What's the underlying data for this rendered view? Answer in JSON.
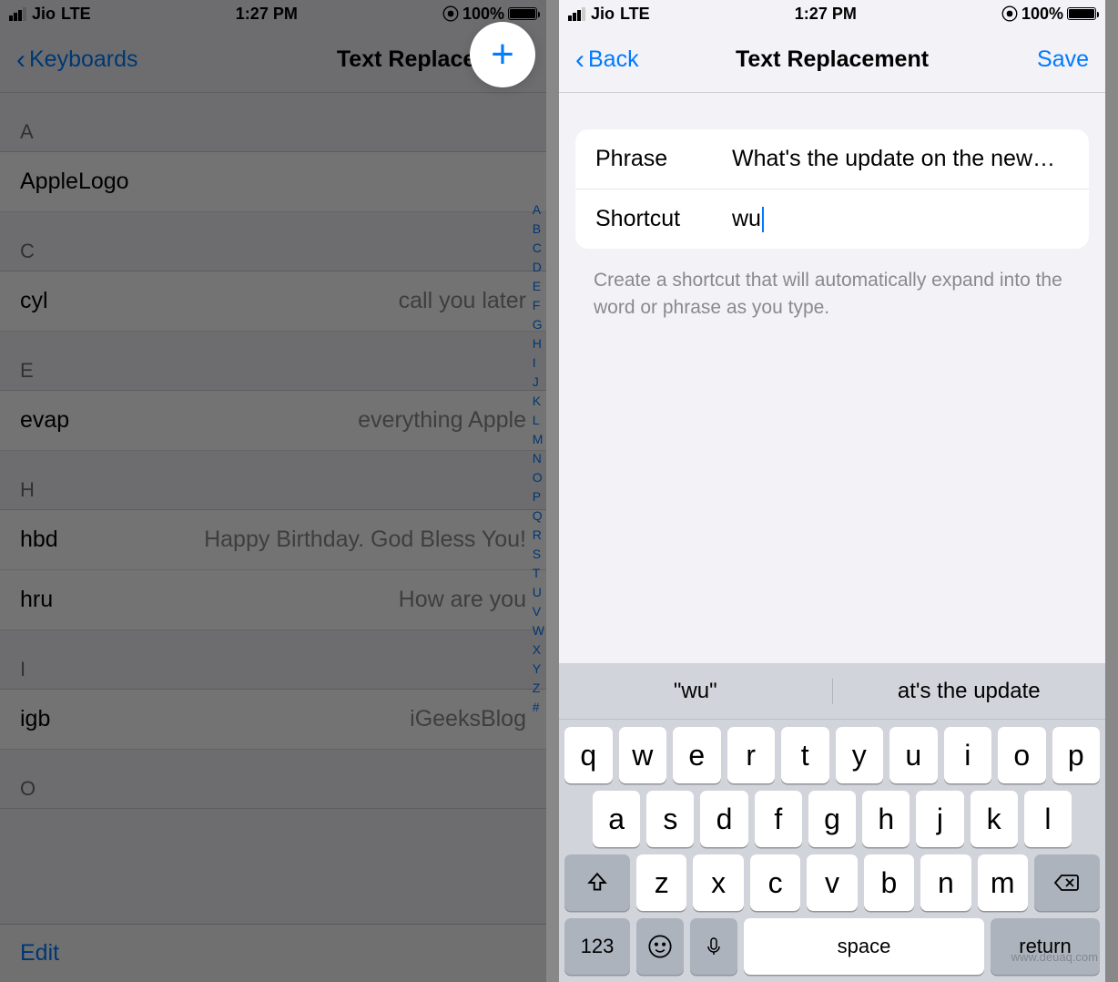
{
  "status": {
    "carrier": "Jio",
    "network": "LTE",
    "time": "1:27 PM",
    "battery_pct": "100%",
    "lock_icon": "⦿"
  },
  "left": {
    "back_label": "Keyboards",
    "title": "Text Replacement",
    "add_label": "+",
    "edit_label": "Edit",
    "sections": [
      {
        "letter": "A",
        "items": [
          {
            "shortcut": "AppleLogo",
            "phrase": ""
          }
        ]
      },
      {
        "letter": "C",
        "items": [
          {
            "shortcut": "cyl",
            "phrase": "call you later"
          }
        ]
      },
      {
        "letter": "E",
        "items": [
          {
            "shortcut": "evap",
            "phrase": "everything Apple"
          }
        ]
      },
      {
        "letter": "H",
        "items": [
          {
            "shortcut": "hbd",
            "phrase": "Happy Birthday. God Bless You!"
          },
          {
            "shortcut": "hru",
            "phrase": "How are you"
          }
        ]
      },
      {
        "letter": "I",
        "items": [
          {
            "shortcut": "igb",
            "phrase": "iGeeksBlog"
          }
        ]
      },
      {
        "letter": "O",
        "items": []
      }
    ],
    "index": [
      "A",
      "B",
      "C",
      "D",
      "E",
      "F",
      "G",
      "H",
      "I",
      "J",
      "K",
      "L",
      "M",
      "N",
      "O",
      "P",
      "Q",
      "R",
      "S",
      "T",
      "U",
      "V",
      "W",
      "X",
      "Y",
      "Z",
      "#"
    ]
  },
  "right": {
    "back_label": "Back",
    "title": "Text Replacement",
    "save_label": "Save",
    "phrase_label": "Phrase",
    "phrase_value": "What's the update on the new…",
    "shortcut_label": "Shortcut",
    "shortcut_value": "wu",
    "hint": "Create a shortcut that will automatically expand into the word or phrase as you type."
  },
  "keyboard": {
    "suggestions": [
      "\"wu\"",
      "at's the update"
    ],
    "row1": [
      "q",
      "w",
      "e",
      "r",
      "t",
      "y",
      "u",
      "i",
      "o",
      "p"
    ],
    "row2": [
      "a",
      "s",
      "d",
      "f",
      "g",
      "h",
      "j",
      "k",
      "l"
    ],
    "row3": [
      "z",
      "x",
      "c",
      "v",
      "b",
      "n",
      "m"
    ],
    "shift": "⇧",
    "delete": "⌫",
    "numbers": "123",
    "emoji": "☺",
    "mic": "🎤",
    "space": "space",
    "return": "return"
  },
  "watermark": "www.deuaq.com"
}
